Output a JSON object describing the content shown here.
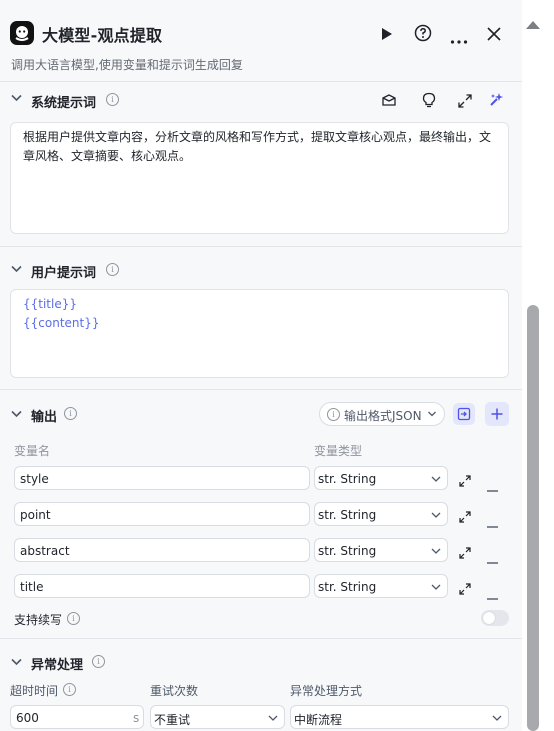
{
  "header": {
    "title": "大模型-观点提取",
    "description": "调用大语言模型,使用变量和提示词生成回复"
  },
  "system_prompt": {
    "label": "系统提示词",
    "text": "根据用户提供文章内容，分析文章的风格和写作方式，提取文章核心观点，最终输出，文章风格、文章摘要、核心观点。"
  },
  "user_prompt": {
    "label": "用户提示词",
    "lines": [
      "{{title}}",
      "{{content}}"
    ]
  },
  "output": {
    "label": "输出",
    "format_button": "输出格式JSON",
    "col_name": "变量名",
    "col_type": "变量类型",
    "rows": [
      {
        "name": "style",
        "type": "str. String"
      },
      {
        "name": "point",
        "type": "str. String"
      },
      {
        "name": "abstract",
        "type": "str. String"
      },
      {
        "name": "title",
        "type": "str. String"
      }
    ],
    "continue_label": "支持续写",
    "continue_enabled": false
  },
  "exception": {
    "label": "异常处理",
    "timeout_label": "超时时间",
    "retry_label": "重试次数",
    "method_label": "异常处理方式",
    "timeout_value": "600",
    "timeout_unit": "s",
    "retry_value": "不重试",
    "method_value": "中断流程"
  },
  "colors": {
    "accent": "#4d53e8",
    "variable": "#5b6ee8"
  }
}
